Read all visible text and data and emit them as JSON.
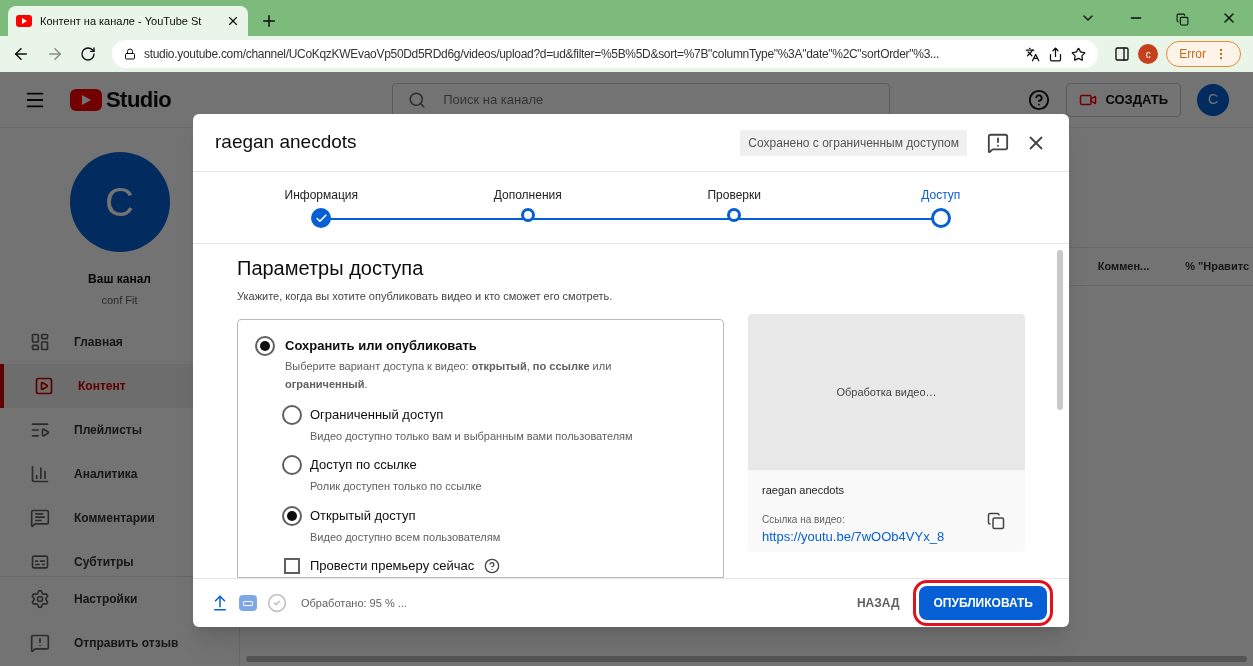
{
  "browser": {
    "tab_title": "Контент на канале - YouTube St",
    "url": "studio.youtube.com/channel/UCoKqzKWEvaoVp50Dd5RDd6g/videos/upload?d=ud&filter=%5B%5D&sort=%7B\"columnType\"%3A\"date\"%2C\"sortOrder\"%3...",
    "profile_letter": "c",
    "error_button": "Error"
  },
  "studio": {
    "logo_text": "Studio",
    "search": {
      "placeholder": "Поиск на канале"
    },
    "create_button": "СОЗДАТЬ",
    "account_letter": "C",
    "channel": {
      "avatar_letter": "C",
      "title": "Ваш канал",
      "name": "conf Fit"
    },
    "nav_items": [
      {
        "label": "Главная",
        "selected": false
      },
      {
        "label": "Контент",
        "selected": true
      },
      {
        "label": "Плейлисты",
        "selected": false
      },
      {
        "label": "Аналитика",
        "selected": false
      },
      {
        "label": "Комментарии",
        "selected": false
      },
      {
        "label": "Субтитры",
        "selected": false
      }
    ],
    "bottom_nav_items": [
      {
        "label": "Настройки"
      },
      {
        "label": "Отправить отзыв"
      }
    ],
    "table": {
      "columns": [
        "Коммен...",
        "% \"Нравитс"
      ]
    }
  },
  "modal": {
    "title": "raegan anecdots",
    "saved_badge": "Сохранено с ограниченным доступом",
    "steps": [
      {
        "label": "Информация",
        "done": true,
        "selected": false
      },
      {
        "label": "Дополнения",
        "done": false,
        "selected": false
      },
      {
        "label": "Проверки",
        "done": false,
        "selected": false
      },
      {
        "label": "Доступ",
        "done": false,
        "selected": true
      }
    ],
    "heading": "Параметры доступа",
    "description": "Укажите, когда вы хотите опубликовать видео и кто сможет его смотреть.",
    "main_option": {
      "label": "Сохранить или опубликовать",
      "description": "Выберите вариант доступа к видео: **открытый**, **по ссылке** или **ограниченный**.",
      "selected": true
    },
    "options": [
      {
        "label": "Ограниченный доступ",
        "description": "Видео доступно только вам и выбранным вами пользователям",
        "selected": false
      },
      {
        "label": "Доступ по ссылке",
        "description": "Ролик доступен только по ссылке",
        "selected": false
      },
      {
        "label": "Открытый доступ",
        "description": "Видео доступно всем пользователям",
        "selected": true
      }
    ],
    "premiere": {
      "label": "Провести премьеру сейчас",
      "checked": false
    },
    "preview": {
      "status": "Обработка видео…",
      "video_title": "raegan anecdots",
      "link_label": "Ссылка на видео:",
      "link": "https://youtu.be/7wOOb4VYx_8"
    },
    "footer": {
      "status": "Обработано: 95 % ...",
      "back_button": "НАЗАД",
      "publish_button": {
        "label": "ОПУБЛИКОВАТЬ",
        "highlighted": true
      }
    }
  }
}
